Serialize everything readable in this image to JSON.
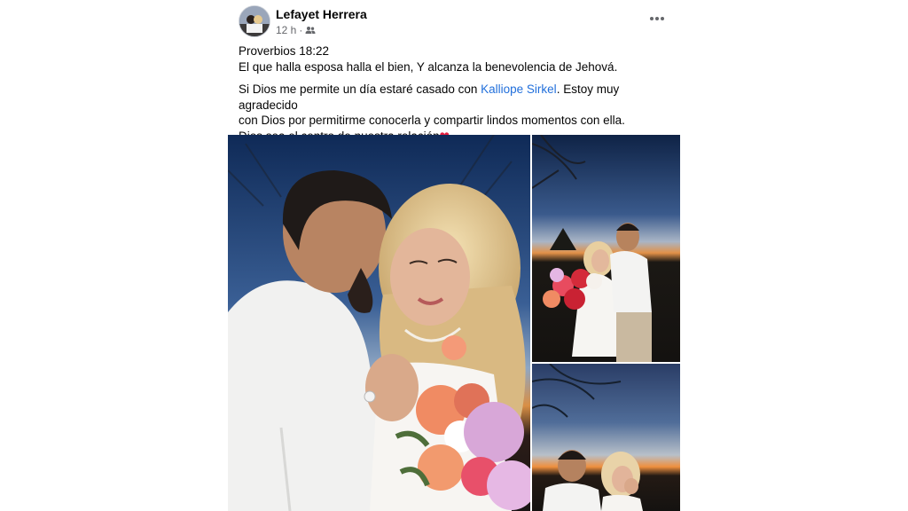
{
  "post": {
    "author": "Lefayet Herrera",
    "time": "12 h",
    "separator": "·",
    "audience_icon": "friends-icon",
    "more_icon": "more-options-icon",
    "lines": {
      "verse_ref": "Proverbios 18:22",
      "verse_text": "El que halla esposa halla el bien, Y alcanza la benevolencia de Jehová.",
      "line1_before": "Si Dios me permite un día estaré casado con ",
      "tagged_name": "Kalliope Sirkel",
      "line1_after": ". Estoy muy agradecido",
      "line2": "con Dios por permitirme conocerla y compartir lindos momentos con ella.",
      "line3": "Dios sea el centro de nuestra relación",
      "heart": "❤"
    }
  },
  "photos": [
    {
      "name": "couple-kiss-photo"
    },
    {
      "name": "couple-bouquet-photo"
    },
    {
      "name": "couple-sunset-photo"
    }
  ],
  "colors": {
    "link": "#216fdb",
    "text": "#050505",
    "secondary_text": "#65676b",
    "heart": "#e41e3f"
  }
}
